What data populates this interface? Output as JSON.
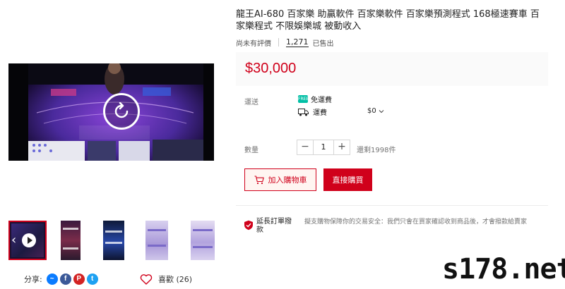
{
  "product": {
    "title": "龍王AI-680 百家樂 助贏軟件 百家樂軟件 百家樂預測程式 168極速賽車 百家樂程式 不限娛樂城 被動收入",
    "rating_text": "尚未有評價",
    "sold_count": "1,271",
    "sold_label": "已售出",
    "price": "$30,000"
  },
  "shipping": {
    "label": "運送",
    "free_label": "免運費",
    "free_icon": "free-shipping-icon",
    "ship_to_label": "運費",
    "fee": "$0"
  },
  "quantity": {
    "label": "數量",
    "minus": "−",
    "value": "1",
    "plus": "+",
    "stock": "還剩1998件"
  },
  "actions": {
    "add_to_cart": "加入購物車",
    "buy_now": "直接購買"
  },
  "guarantee": {
    "title": "延長訂單撥款",
    "text": "擬支購物保障你的交易安全：我們只會在買家確認收到商品後，才會撥款給賣家"
  },
  "share": {
    "label": "分享:",
    "icons": [
      "messenger-icon",
      "facebook-icon",
      "pinterest-icon",
      "twitter-icon"
    ],
    "icon_glyphs": [
      "~",
      "f",
      "P",
      "t"
    ]
  },
  "likes": {
    "label": "喜歡 (26)"
  },
  "watermark": "s178.net",
  "colors": {
    "accent": "#d0011b",
    "free_shipping": "#00bfa5",
    "price_bg": "#fafafa"
  }
}
